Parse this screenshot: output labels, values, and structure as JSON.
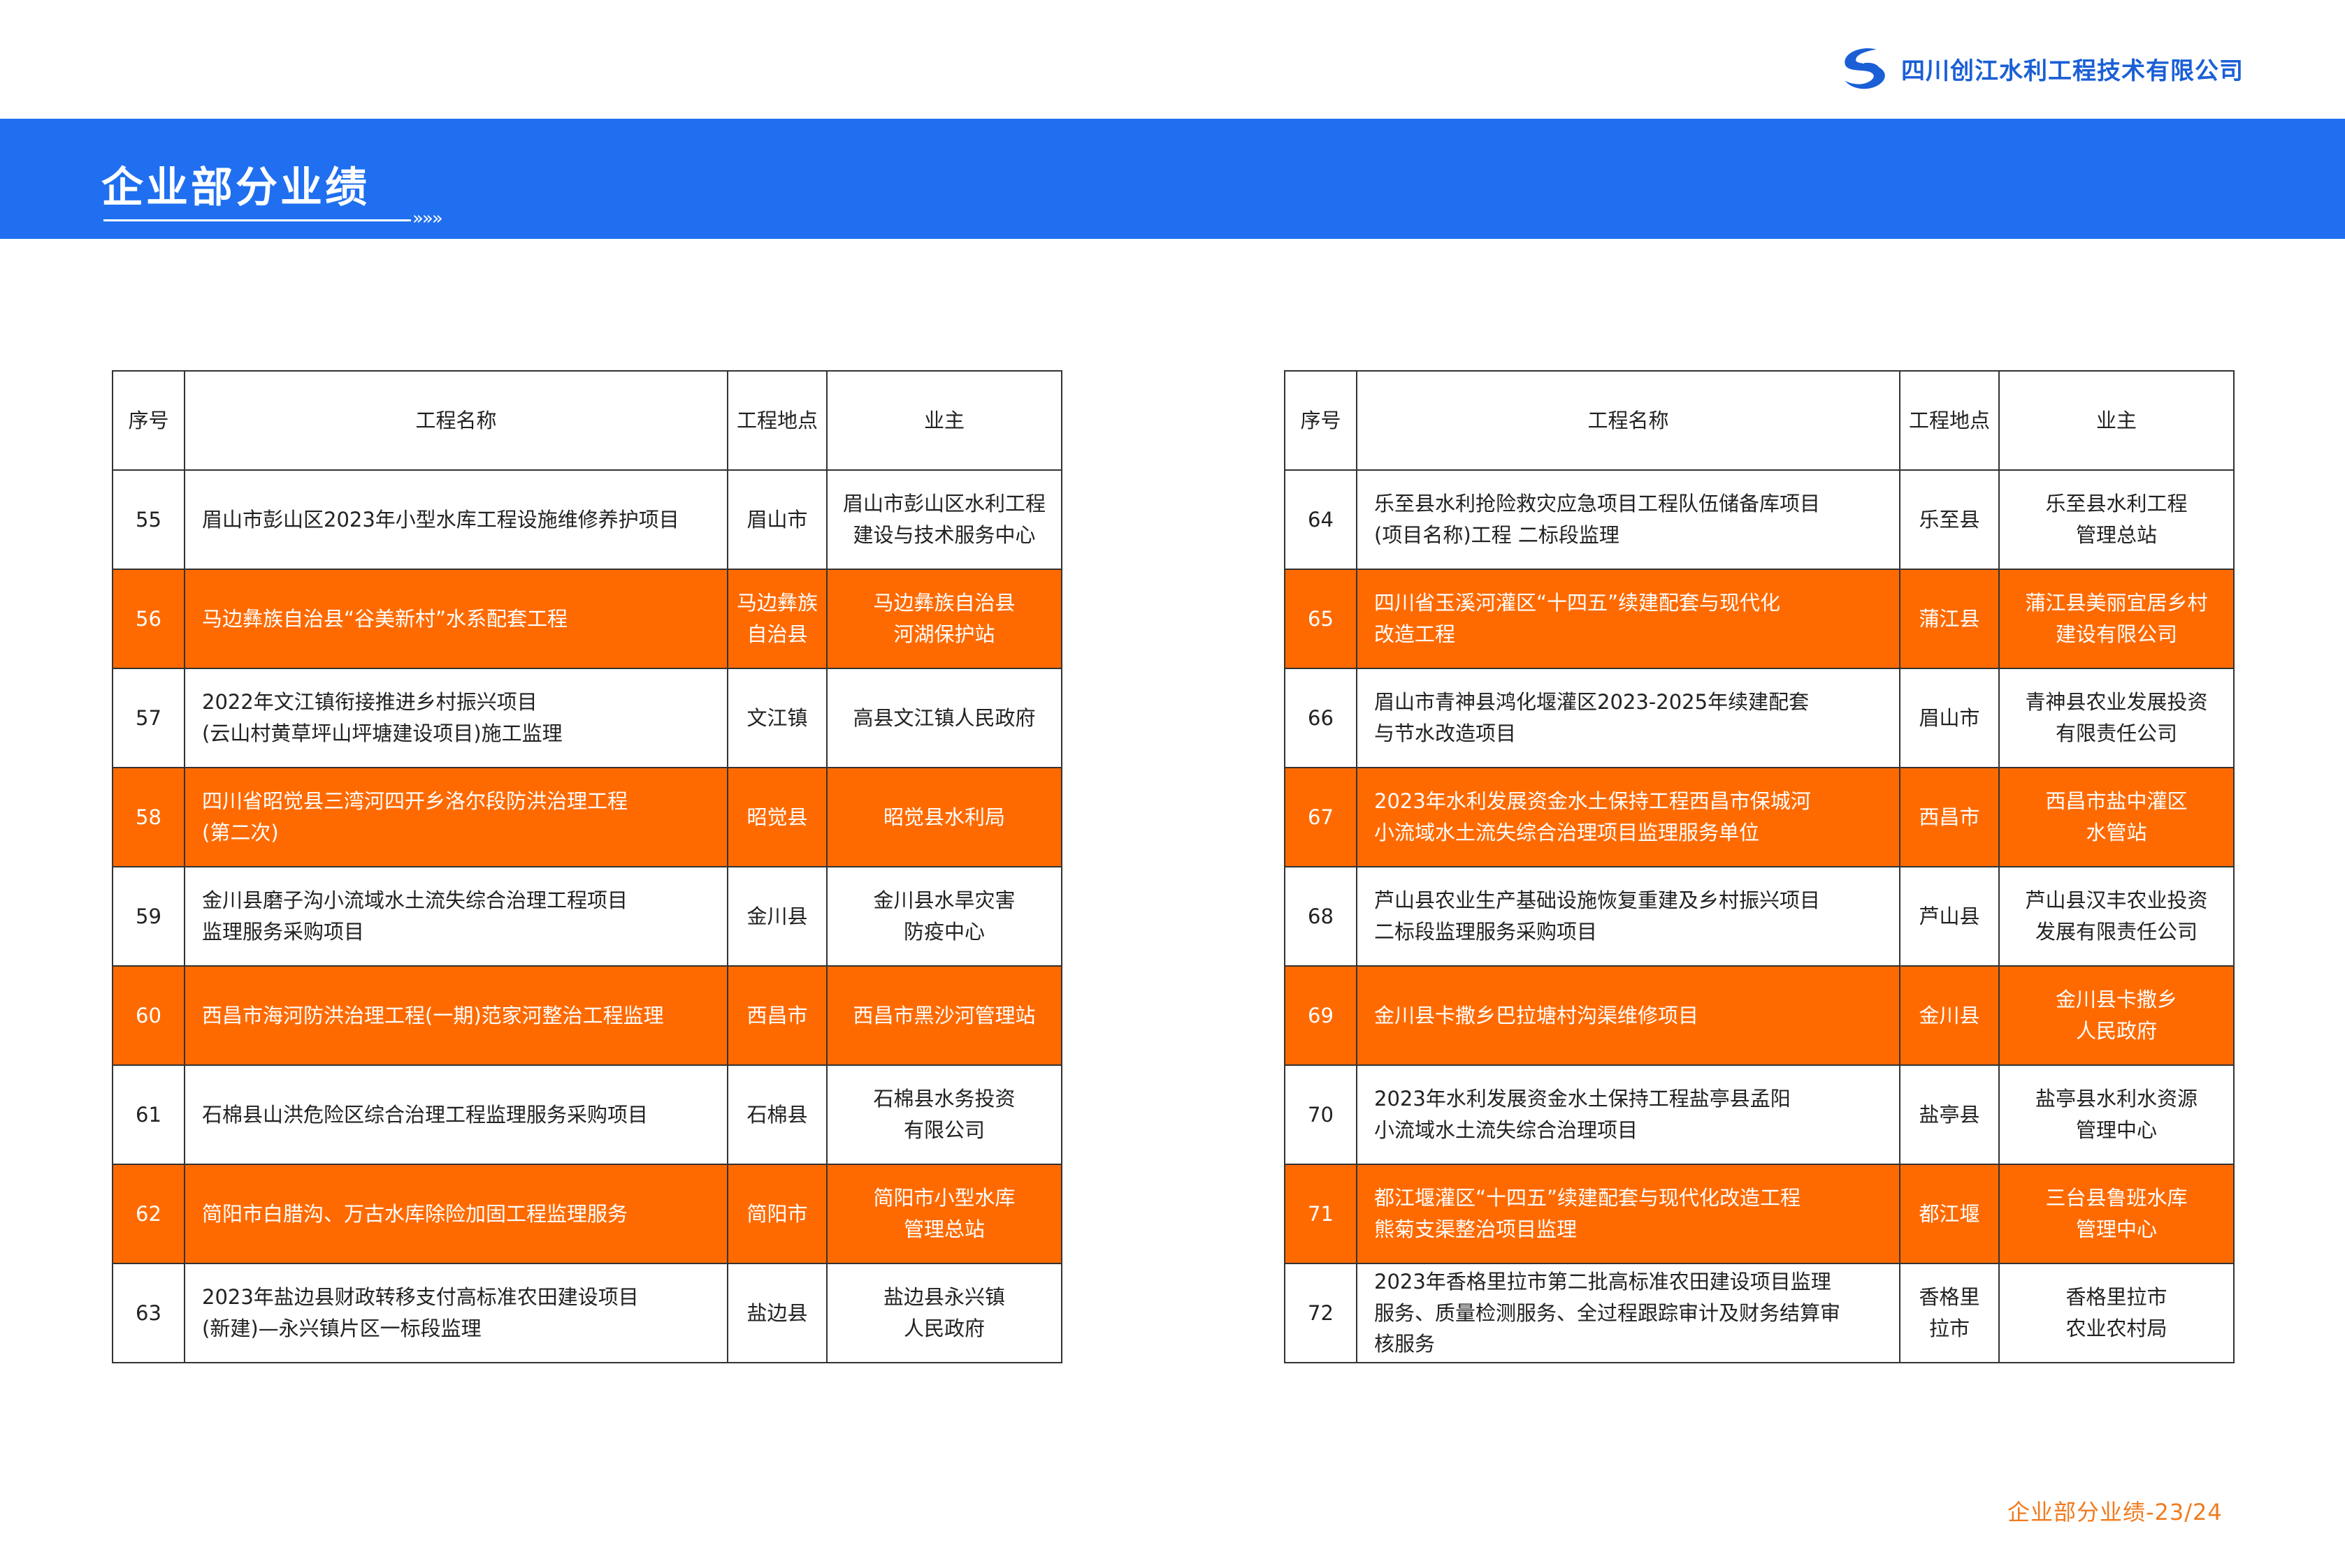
{
  "company": {
    "name": "四川创江水利工程技术有限公司",
    "logo_icon": "company-logo-icon"
  },
  "banner": {
    "title": "企业部分业绩",
    "arrows": "»»»"
  },
  "table": {
    "headers": [
      "序号",
      "工程名称",
      "工程地点",
      "业主"
    ],
    "left_rows": [
      {
        "no": "55",
        "name": [
          "眉山市彭山区2023年小型水库工程设施维修养护项目"
        ],
        "location": [
          "眉山市"
        ],
        "owner": [
          "眉山市彭山区水利工程",
          "建设与技术服务中心"
        ],
        "highlight": false
      },
      {
        "no": "56",
        "name": [
          "马边彝族自治县“谷美新村”水系配套工程"
        ],
        "location": [
          "马边彝族",
          "自治县"
        ],
        "owner": [
          "马边彝族自治县",
          "河湖保护站"
        ],
        "highlight": true
      },
      {
        "no": "57",
        "name": [
          "2022年文江镇衔接推进乡村振兴项目",
          "(云山村黄草坪山坪塘建设项目)施工监理"
        ],
        "location": [
          "文江镇"
        ],
        "owner": [
          "高县文江镇人民政府"
        ],
        "highlight": false
      },
      {
        "no": "58",
        "name": [
          "四川省昭觉县三湾河四开乡洛尔段防洪治理工程",
          "(第二次)"
        ],
        "location": [
          "昭觉县"
        ],
        "owner": [
          "昭觉县水利局"
        ],
        "highlight": true
      },
      {
        "no": "59",
        "name": [
          "金川县磨子沟小流域水土流失综合治理工程项目",
          "监理服务采购项目"
        ],
        "location": [
          "金川县"
        ],
        "owner": [
          "金川县水旱灾害",
          "防疫中心"
        ],
        "highlight": false
      },
      {
        "no": "60",
        "name": [
          "西昌市海河防洪治理工程(一期)范家河整治工程监理"
        ],
        "location": [
          "西昌市"
        ],
        "owner": [
          "西昌市黑沙河管理站"
        ],
        "highlight": true
      },
      {
        "no": "61",
        "name": [
          "石棉县山洪危险区综合治理工程监理服务采购项目"
        ],
        "location": [
          "石棉县"
        ],
        "owner": [
          "石棉县水务投资",
          "有限公司"
        ],
        "highlight": false
      },
      {
        "no": "62",
        "name": [
          "简阳市白腊沟、万古水库除险加固工程监理服务"
        ],
        "location": [
          "简阳市"
        ],
        "owner": [
          "简阳市小型水库",
          "管理总站"
        ],
        "highlight": true
      },
      {
        "no": "63",
        "name": [
          "2023年盐边县财政转移支付高标准农田建设项目",
          "(新建)—永兴镇片区一标段监理"
        ],
        "location": [
          "盐边县"
        ],
        "owner": [
          "盐边县永兴镇",
          "人民政府"
        ],
        "highlight": false
      }
    ],
    "right_rows": [
      {
        "no": "64",
        "name": [
          "乐至县水利抢险救灾应急项目工程队伍储备库项目",
          "(项目名称)工程 二标段监理"
        ],
        "location": [
          "乐至县"
        ],
        "owner": [
          "乐至县水利工程",
          "管理总站"
        ],
        "highlight": false
      },
      {
        "no": "65",
        "name": [
          "四川省玉溪河灌区“十四五”续建配套与现代化",
          "改造工程"
        ],
        "location": [
          "蒲江县"
        ],
        "owner": [
          "蒲江县美丽宜居乡村",
          "建设有限公司"
        ],
        "highlight": true
      },
      {
        "no": "66",
        "name": [
          "眉山市青神县鸿化堰灌区2023-2025年续建配套",
          "与节水改造项目"
        ],
        "location": [
          "眉山市"
        ],
        "owner": [
          "青神县农业发展投资",
          "有限责任公司"
        ],
        "highlight": false
      },
      {
        "no": "67",
        "name": [
          "2023年水利发展资金水土保持工程西昌市保城河",
          "小流域水土流失综合治理项目监理服务单位"
        ],
        "location": [
          "西昌市"
        ],
        "owner": [
          "西昌市盐中灌区",
          "水管站"
        ],
        "highlight": true
      },
      {
        "no": "68",
        "name": [
          "芦山县农业生产基础设施恢复重建及乡村振兴项目",
          "二标段监理服务采购项目"
        ],
        "location": [
          "芦山县"
        ],
        "owner": [
          "芦山县汉丰农业投资",
          "发展有限责任公司"
        ],
        "highlight": false
      },
      {
        "no": "69",
        "name": [
          "金川县卡撒乡巴拉塘村沟渠维修项目"
        ],
        "location": [
          "金川县"
        ],
        "owner": [
          "金川县卡撒乡",
          "人民政府"
        ],
        "highlight": true
      },
      {
        "no": "70",
        "name": [
          " 2023年水利发展资金水土保持工程盐亭县孟阳",
          "小流域水土流失综合治理项目"
        ],
        "location": [
          "盐亭县"
        ],
        "owner": [
          "盐亭县水利水资源",
          "管理中心"
        ],
        "highlight": false
      },
      {
        "no": "71",
        "name": [
          "都江堰灌区“十四五”续建配套与现代化改造工程",
          "熊菊支渠整治项目监理"
        ],
        "location": [
          "都江堰"
        ],
        "owner": [
          "三台县鲁班水库",
          "管理中心"
        ],
        "highlight": true
      },
      {
        "no": "72",
        "name": [
          "2023年香格里拉市第二批高标准农田建设项目监理",
          "服务、质量检测服务、全过程跟踪审计及财务结算审",
          "核服务"
        ],
        "location": [
          "香格里",
          "拉市"
        ],
        "owner": [
          "香格里拉市",
          "农业农村局"
        ],
        "highlight": false
      }
    ]
  },
  "footer": {
    "page": "企业部分业绩-23/24"
  },
  "colors": {
    "banner": "#1f6ff0",
    "highlight": "#ff6a00",
    "footer": "#f07b1e",
    "logo": "#1a5fd6"
  }
}
